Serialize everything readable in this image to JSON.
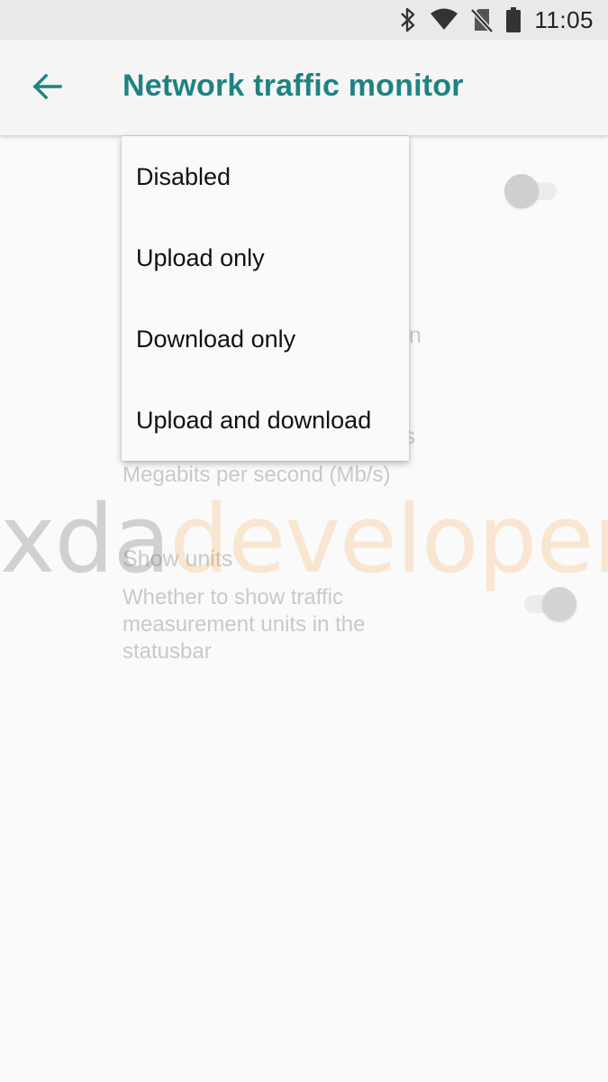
{
  "status_bar": {
    "time": "11:05",
    "icons": [
      "bluetooth-icon",
      "wifi-icon",
      "no-sim-icon",
      "battery-icon"
    ]
  },
  "app_bar": {
    "title": "Network traffic monitor",
    "back_icon": "arrow-left-icon",
    "accent_color": "#1e8380"
  },
  "settings": {
    "row_1": {
      "partial_title_visible": "en",
      "switch_on": false
    },
    "row_2": {
      "partial_title_visible": "its",
      "summary": "Megabits per second (Mb/s)"
    },
    "row_3": {
      "title": "Show units",
      "summary_lines": [
        "Whether to show traffic",
        "measurement units in the",
        "statusbar"
      ],
      "switch_on": true
    }
  },
  "popup_menu": {
    "options": [
      "Disabled",
      "Upload only",
      "Download only",
      "Upload and download"
    ]
  },
  "watermark": {
    "part_a": "xda",
    "part_b": "developers"
  }
}
